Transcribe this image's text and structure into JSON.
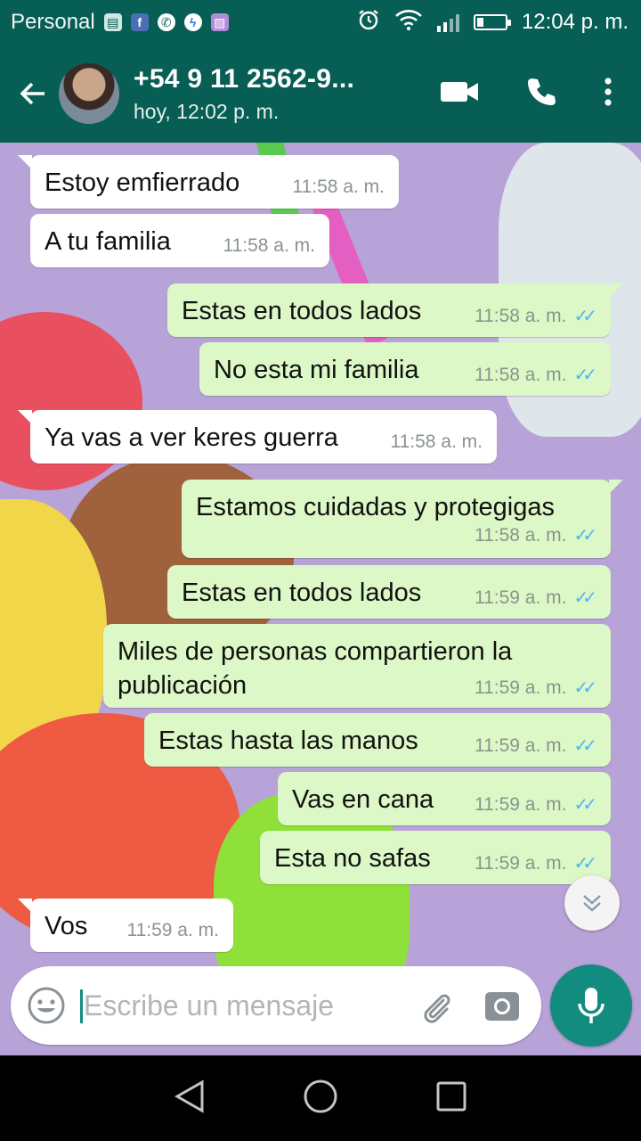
{
  "status_bar": {
    "carrier": "Personal",
    "time": "12:04 p. m.",
    "app_icons": [
      "sim-icon",
      "facebook-icon",
      "whatsapp-icon",
      "messenger-icon",
      "gallery-icon"
    ],
    "right_icons": [
      "alarm-icon",
      "wifi-icon",
      "signal-icon",
      "battery-icon"
    ]
  },
  "header": {
    "contact_name": "+54 9 11 2562-9...",
    "last_seen": "hoy, 12:02 p. m."
  },
  "messages": [
    {
      "dir": "in",
      "text": "Estoy emfierrado",
      "time": "11:58 a. m."
    },
    {
      "dir": "in",
      "text": "A tu familia",
      "time": "11:58 a. m."
    },
    {
      "dir": "out",
      "text": "Estas en todos lados",
      "time": "11:58 a. m."
    },
    {
      "dir": "out",
      "text": "No esta mi familia",
      "time": "11:58 a. m."
    },
    {
      "dir": "in",
      "text": "Ya vas a ver keres guerra",
      "time": "11:58 a. m."
    },
    {
      "dir": "out",
      "text": "Estamos cuidadas y protegigas",
      "time": "11:58 a. m."
    },
    {
      "dir": "out",
      "text": "Estas en todos lados",
      "time": "11:59 a. m."
    },
    {
      "dir": "out",
      "text": "Miles de personas compartieron la publicación",
      "time": "11:59 a. m."
    },
    {
      "dir": "out",
      "text": "Estas hasta las manos",
      "time": "11:59 a. m."
    },
    {
      "dir": "out",
      "text": "Vas en cana",
      "time": "11:59 a. m."
    },
    {
      "dir": "out",
      "text": "Esta no safas",
      "time": "11:59 a. m."
    },
    {
      "dir": "in",
      "text": "Vos",
      "time": "11:59 a. m."
    }
  ],
  "input": {
    "placeholder": "Escribe un mensaje"
  },
  "colors": {
    "header": "#075e54",
    "accent": "#128c7e",
    "outgoing_bubble": "#dcf8c6",
    "incoming_bubble": "#ffffff",
    "read_ticks": "#4fb6ec"
  }
}
